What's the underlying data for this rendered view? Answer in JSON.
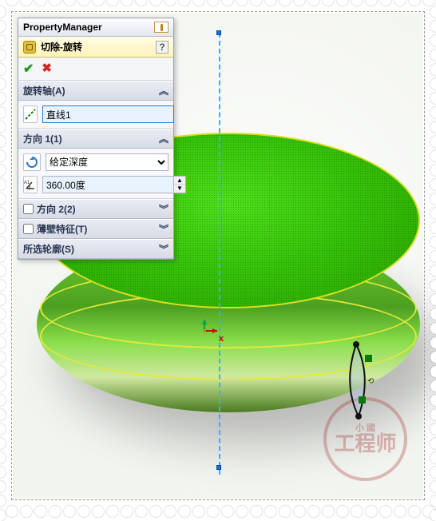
{
  "panel": {
    "title": "PropertyManager",
    "feature_name": "切除-旋转",
    "axis": {
      "header": "旋转轴(A)",
      "value": "直线1"
    },
    "dir1": {
      "header": "方向 1(1)",
      "type_selected": "给定深度",
      "angle": "360.00度"
    },
    "dir2": {
      "header": "方向 2(2)"
    },
    "thin": {
      "header": "薄壁特征(T)"
    },
    "contour": {
      "header": "所选轮廓(S)"
    }
  },
  "watermark": {
    "small": "小 國",
    "main": "工程师"
  }
}
